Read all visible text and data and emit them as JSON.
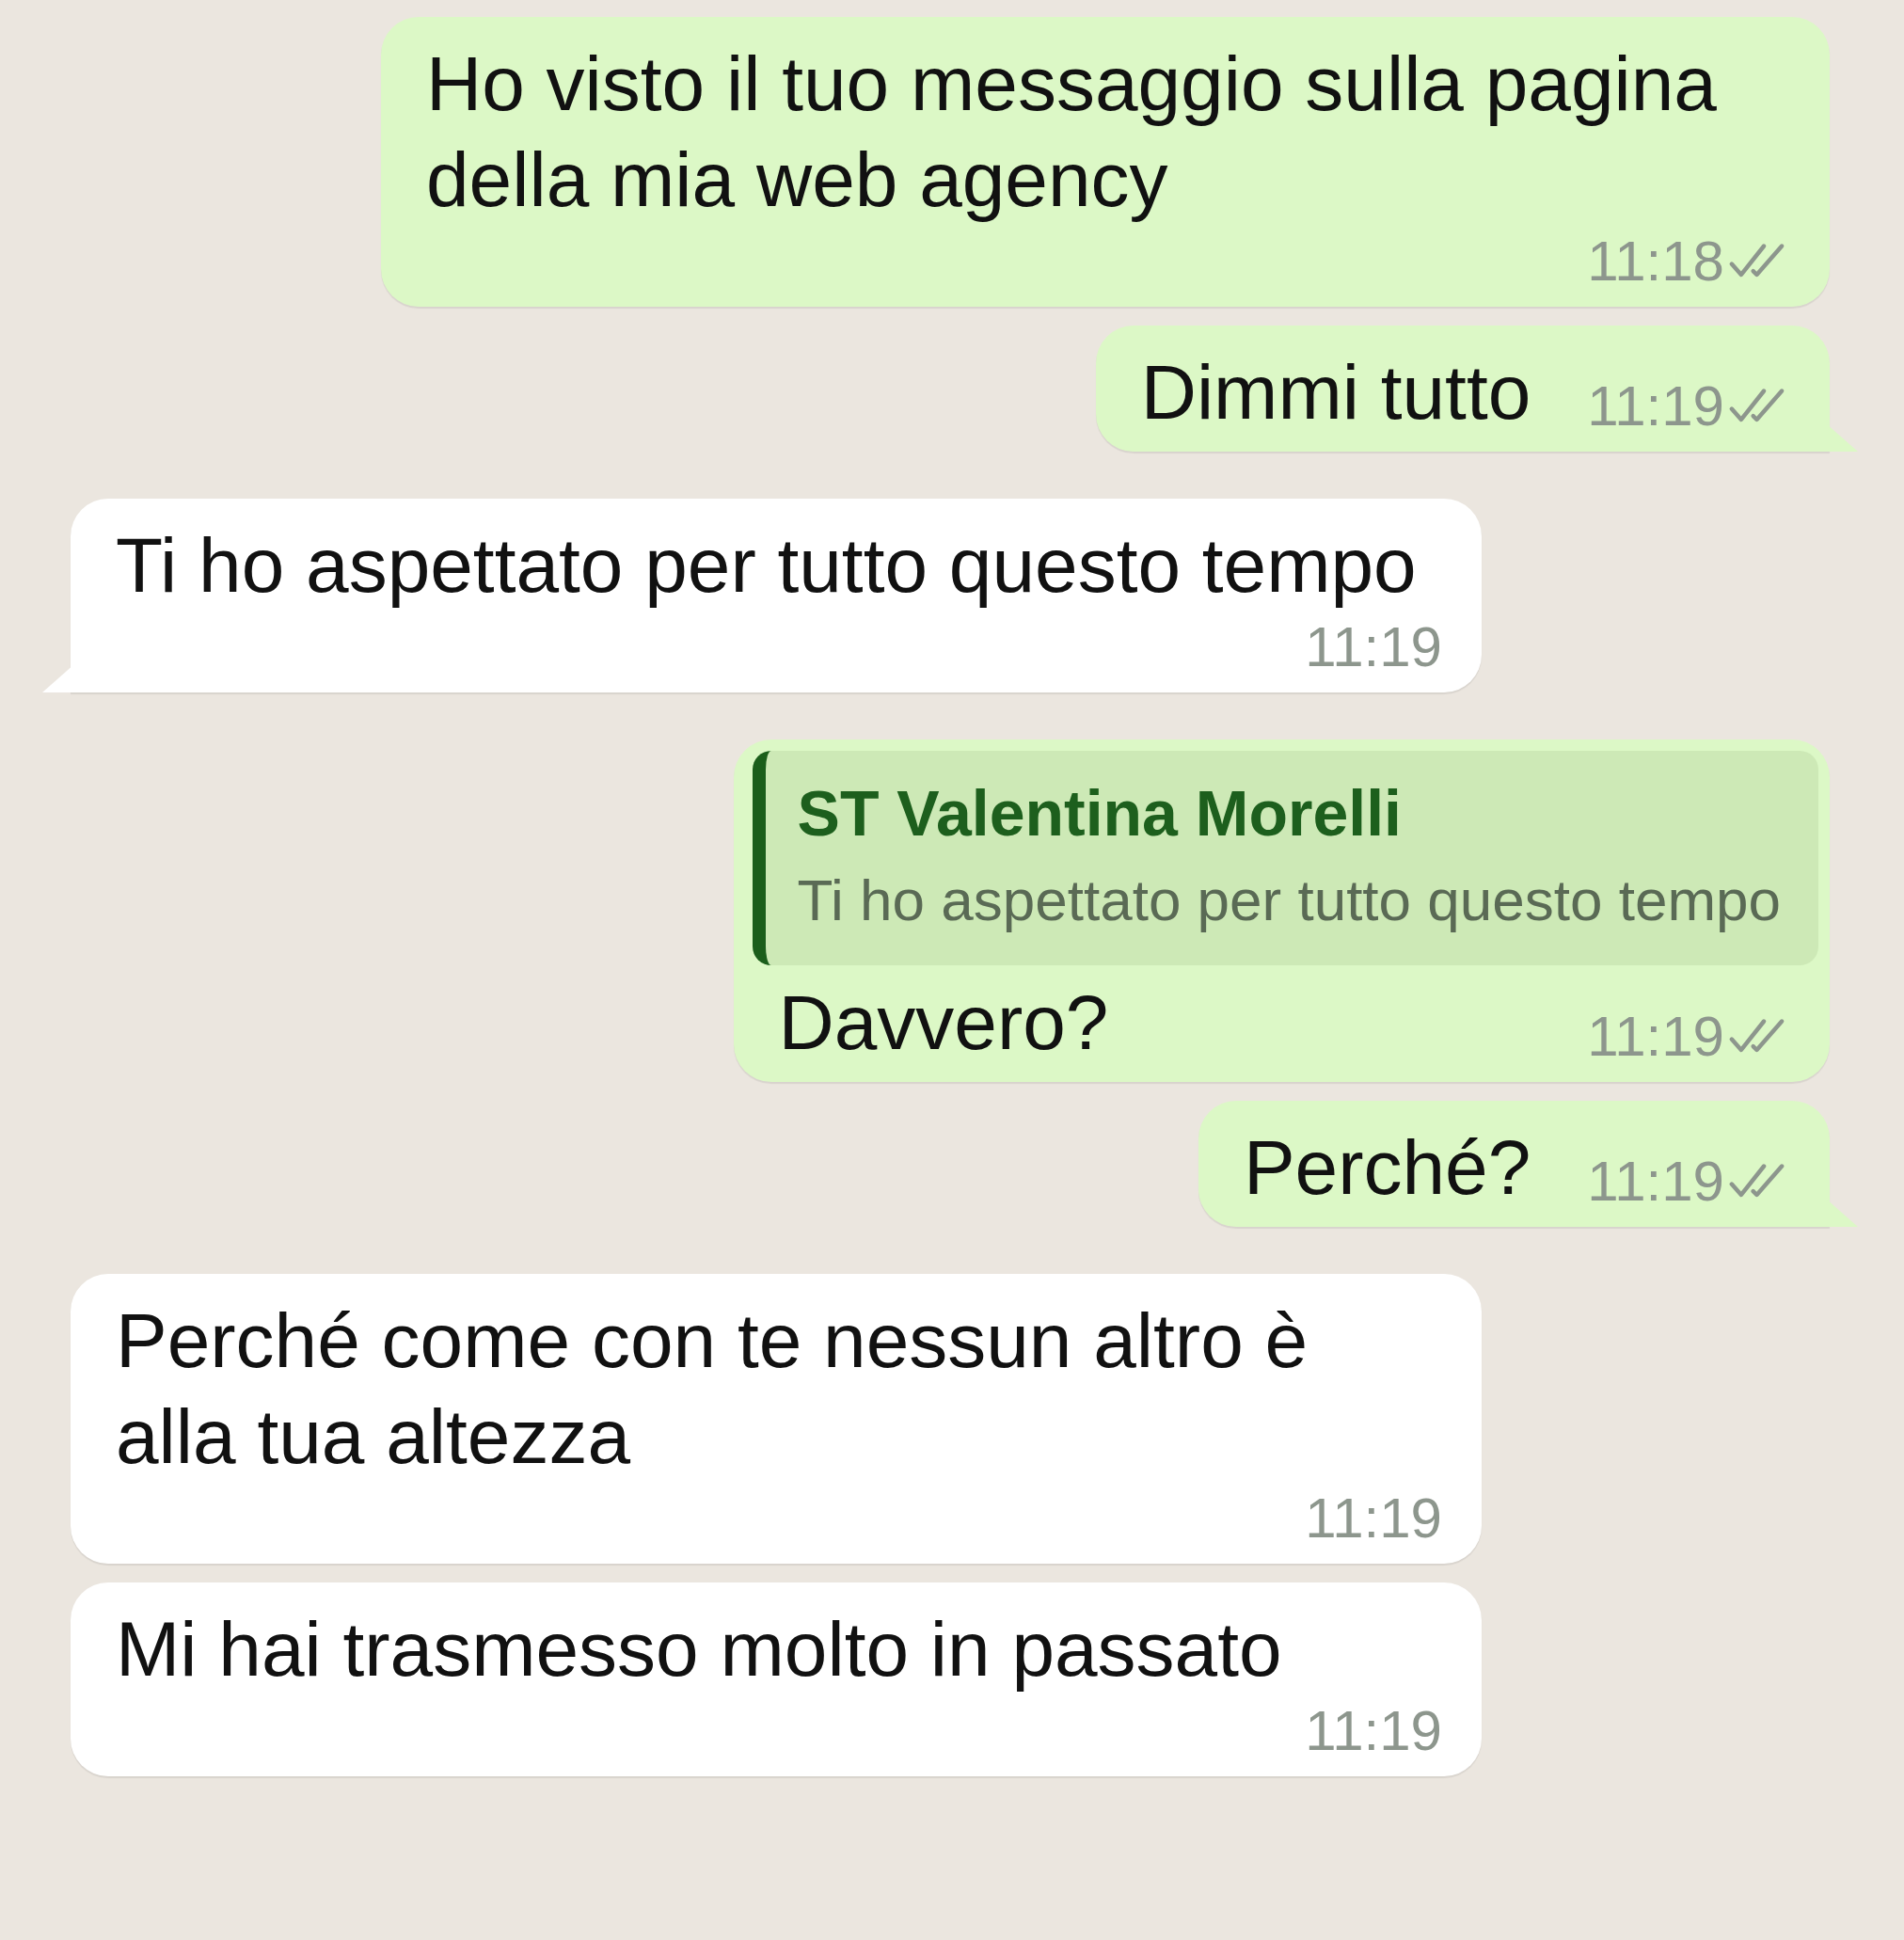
{
  "messages": [
    {
      "kind": "sent",
      "text": "Ho visto il tuo messaggio sulla pagina della mia web agency",
      "time": "11:18",
      "read": false,
      "tail": false
    },
    {
      "kind": "sent",
      "text": "Dimmi tutto",
      "time": "11:19",
      "read": false,
      "tail": true
    },
    {
      "kind": "received",
      "text": "Ti ho aspettato per tutto questo tempo",
      "time": "11:19",
      "tail": true
    },
    {
      "kind": "sent",
      "quote": {
        "author": "ST Valentina Morelli",
        "text": "Ti ho aspettato per tutto questo tempo"
      },
      "text": "Davvero?",
      "time": "11:19",
      "read": false,
      "tail": false
    },
    {
      "kind": "sent",
      "text": "Perché?",
      "time": "11:19",
      "read": false,
      "tail": true
    },
    {
      "kind": "received",
      "text": "Perché come con te nessun altro è alla tua altezza",
      "time": "11:19",
      "tail": false
    },
    {
      "kind": "received",
      "text": "Mi hai trasmesso molto in passato",
      "time": "11:19",
      "tail": false
    }
  ]
}
